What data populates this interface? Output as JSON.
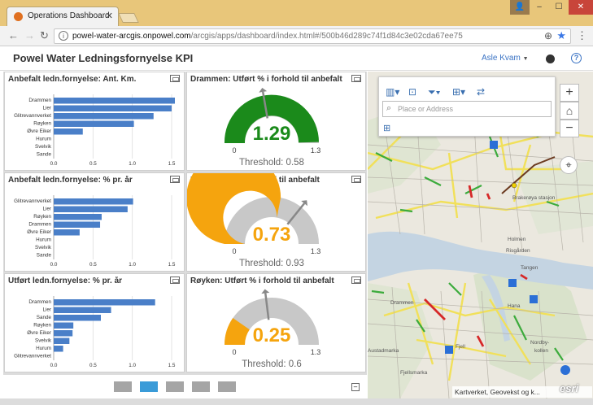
{
  "browser": {
    "tab_title": "Operations Dashboard",
    "url_host": "powel-water-arcgis.onpowel.com",
    "url_path": "/arcgis/apps/dashboard/index.html#/500b46d289c74f1d84c3e02cda67ee75"
  },
  "app": {
    "title": "Powel Water Ledningsfornyelse KPI",
    "user": "Asle Kvam"
  },
  "bar_panels": [
    {
      "title": "Anbefalt ledn.fornyelse: Ant. Km.",
      "chart_data": {
        "type": "bar",
        "categories": [
          "Drammen",
          "Lier",
          "Glitrevannverket",
          "Røyken",
          "Øvre Eiker",
          "Hurum",
          "Svelvik",
          "Sande"
        ],
        "values": [
          1.55,
          1.5,
          1.27,
          1.02,
          0.37,
          0,
          0,
          0
        ],
        "xlim": [
          0,
          1.5
        ],
        "ticks": [
          "0.0",
          "0.5",
          "1.0",
          "1.5"
        ]
      }
    },
    {
      "title": "Anbefalt ledn.fornyelse: % pr. år",
      "chart_data": {
        "type": "bar",
        "categories": [
          "Glitrevannverket",
          "Lier",
          "Røyken",
          "Drammen",
          "Øvre Eiker",
          "Hurum",
          "Svelvik",
          "Sande"
        ],
        "values": [
          1.01,
          0.94,
          0.61,
          0.59,
          0.33,
          0,
          0,
          0
        ],
        "xlim": [
          0,
          1.5
        ],
        "ticks": [
          "0.0",
          "0.5",
          "1.0",
          "1.5"
        ]
      }
    },
    {
      "title": "Utført ledn.fornyelse: % pr. år",
      "chart_data": {
        "type": "bar",
        "categories": [
          "Drammen",
          "Lier",
          "Sande",
          "Røyken",
          "Øvre Eiker",
          "Svelvik",
          "Hurum",
          "Glitrevannverket"
        ],
        "values": [
          1.29,
          0.73,
          0.6,
          0.25,
          0.24,
          0.2,
          0.12,
          0
        ],
        "xlim": [
          0,
          1.5
        ],
        "ticks": [
          "0.0",
          "0.5",
          "1.0",
          "1.5"
        ]
      }
    }
  ],
  "gauges": [
    {
      "title": "Drammen: Utført % i forhold til anbefalt",
      "value": 1.29,
      "value_label": "1.29",
      "min": 0,
      "max": 1.3,
      "min_label": "0",
      "max_label": "1.3",
      "threshold": 0.58,
      "threshold_label": "Threshold: 0.58",
      "fill_color": "#1b8a1b",
      "value_color": "#1b8a1b"
    },
    {
      "title": "Lier: Utført % i forhold til anbefalt",
      "value": 0.73,
      "value_label": "0.73",
      "min": 0,
      "max": 1.3,
      "min_label": "0",
      "max_label": "1.3",
      "threshold": 0.93,
      "threshold_label": "Threshold: 0.93",
      "fill_color": "#f5a40e",
      "value_color": "#f5a40e"
    },
    {
      "title": "Røyken: Utført % i forhold til anbefalt",
      "value": 0.25,
      "value_label": "0.25",
      "min": 0,
      "max": 1.3,
      "min_label": "0",
      "max_label": "1.3",
      "threshold": 0.6,
      "threshold_label": "Threshold: 0.6",
      "fill_color": "#f5a40e",
      "value_color": "#f5a40e"
    }
  ],
  "chart_data": [
    {
      "type": "bar",
      "title": "Anbefalt ledn.fornyelse: Ant. Km.",
      "categories": [
        "Drammen",
        "Lier",
        "Glitrevannverket",
        "Røyken",
        "Øvre Eiker",
        "Hurum",
        "Svelvik",
        "Sande"
      ],
      "values": [
        1.55,
        1.5,
        1.27,
        1.02,
        0.37,
        0,
        0,
        0
      ]
    },
    {
      "type": "bar",
      "title": "Anbefalt ledn.fornyelse: % pr. år",
      "categories": [
        "Glitrevannverket",
        "Lier",
        "Røyken",
        "Drammen",
        "Øvre Eiker",
        "Hurum",
        "Svelvik",
        "Sande"
      ],
      "values": [
        1.01,
        0.94,
        0.61,
        0.59,
        0.33,
        0,
        0,
        0
      ]
    },
    {
      "type": "bar",
      "title": "Utført ledn.fornyelse: % pr. år",
      "categories": [
        "Drammen",
        "Lier",
        "Sande",
        "Røyken",
        "Øvre Eiker",
        "Svelvik",
        "Hurum",
        "Glitrevannverket"
      ],
      "values": [
        1.29,
        0.73,
        0.6,
        0.25,
        0.24,
        0.2,
        0.12,
        0
      ]
    }
  ],
  "map": {
    "search_placeholder": "Place or Address",
    "attribution": "Kartverket, Geovekst og k...",
    "logo": "esri",
    "labels": [
      "Brakerøya stasjon",
      "Holmen",
      "Risgården",
      "Tangen",
      "Drammen",
      "Hana",
      "Nordby-",
      "kollen",
      "Austadmarka",
      "Fjell",
      "Fjellsmarka"
    ]
  },
  "footer": {
    "pages": 5,
    "active_page": 2
  },
  "colors": {
    "bar": "#4a7fc8",
    "gauge_track": "#c8c8c8",
    "accent": "#3a73c4"
  }
}
